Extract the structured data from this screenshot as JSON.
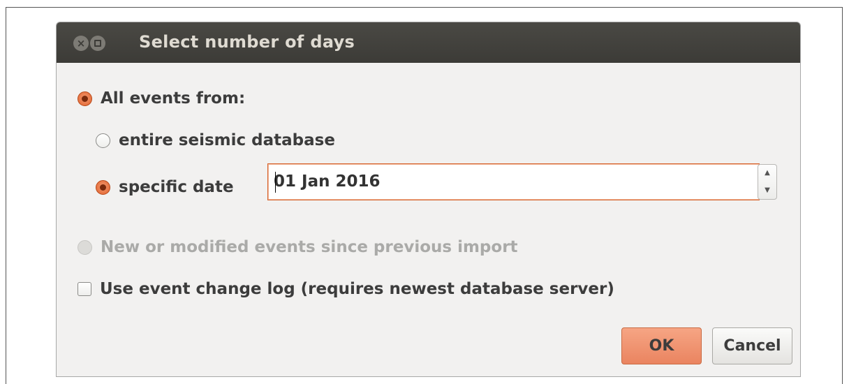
{
  "window": {
    "title": "Select number of days"
  },
  "options": {
    "all_events": {
      "label": "All events from:",
      "selected": true
    },
    "entire_db": {
      "label": "entire seismic database",
      "selected": false
    },
    "specific_date": {
      "label": "specific date",
      "selected": true
    },
    "date_value": "01 Jan 2016",
    "new_modified": {
      "label": "New or modified events since previous import",
      "selected": false,
      "enabled": false
    },
    "change_log": {
      "label": "Use event change log (requires newest database server)",
      "checked": false
    }
  },
  "buttons": {
    "ok": "OK",
    "cancel": "Cancel"
  },
  "colors": {
    "accent": "#e1612b",
    "titlebar": "#3c3b37",
    "dialog_bg": "#f2f1f0"
  },
  "icons": {
    "close": "close-icon",
    "maximize": "maximize-icon",
    "spin_up": "chevron-up-icon",
    "spin_down": "chevron-down-icon"
  }
}
